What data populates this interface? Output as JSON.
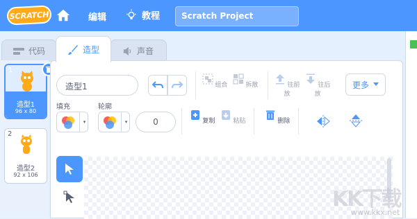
{
  "menubar": {
    "logo_text": "SCRATCH",
    "edit_label": "编辑",
    "tutorials_label": "教程",
    "project_title": "Scratch Project"
  },
  "tabs": [
    {
      "label": "代码",
      "icon": "code-icon"
    },
    {
      "label": "造型",
      "icon": "brush-icon",
      "active": true
    },
    {
      "label": "声音",
      "icon": "speaker-icon"
    }
  ],
  "costumes": [
    {
      "number": "1",
      "name": "造型1",
      "size": "96 x 80",
      "selected": true
    },
    {
      "number": "2",
      "name": "造型2",
      "size": "92 x 106",
      "selected": false
    }
  ],
  "editor": {
    "costume_name": "造型1",
    "group_label": "组合",
    "ungroup_label": "拆散",
    "forward_label": "往前放",
    "backward_label": "往后放",
    "more_label": "更多",
    "fill_label": "填充",
    "outline_label": "轮廓",
    "outline_width": "0",
    "copy_label": "复制",
    "paste_label": "粘贴",
    "delete_label": "删除"
  },
  "watermark": {
    "text": "KK下载",
    "url": "www.kkx.net"
  },
  "colors": {
    "primary": "#4c97ff",
    "logo": "#ffab19",
    "flag": "#4cbf56"
  }
}
